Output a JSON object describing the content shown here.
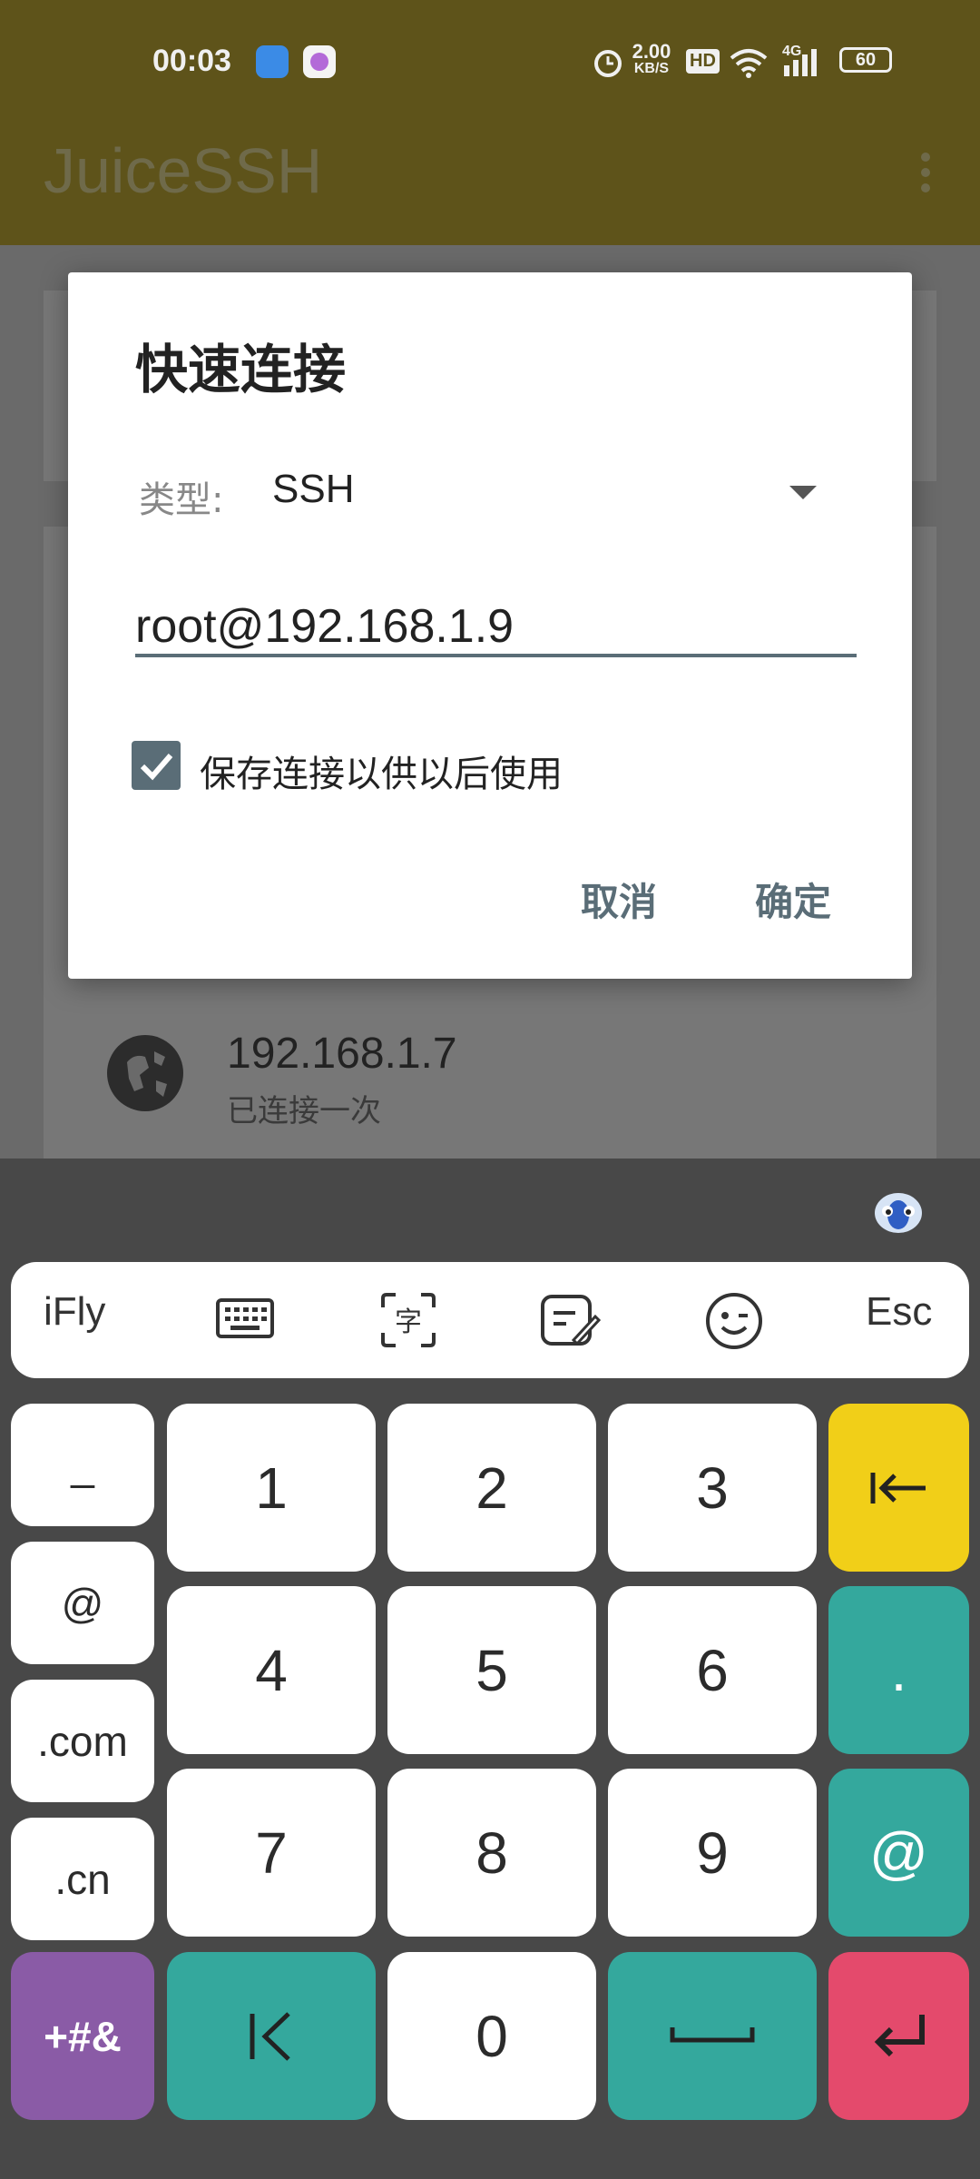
{
  "status_bar": {
    "time": "00:03",
    "speed": "2.00",
    "speed_unit": "KB/S",
    "hd": "HD",
    "network": "4G",
    "battery": "60"
  },
  "app_bar": {
    "title": "JuiceSSH"
  },
  "dialog": {
    "title": "快速连接",
    "type_label": "类型:",
    "type_value": "SSH",
    "host_value": "root@192.168.1.9",
    "save_label": "保存连接以供以后使用",
    "save_checked": true,
    "cancel_label": "取消",
    "ok_label": "确定"
  },
  "background_list": {
    "item_title": "192.168.1.7",
    "item_subtitle": "已连接一次"
  },
  "keyboard": {
    "toolbar": {
      "ifly": "iFly",
      "esc": "Esc"
    },
    "side_keys": [
      "_",
      "@",
      ".com",
      ".cn"
    ],
    "num_keys": [
      "1",
      "2",
      "3",
      "4",
      "5",
      "6",
      "7",
      "8",
      "9",
      "0"
    ],
    "right_keys": [
      ".",
      "@"
    ],
    "symbol_key": "+#&"
  },
  "colors": {
    "app_bar": "#5e531a",
    "accent": "#5a6d77",
    "teal": "#34a89d",
    "yellow": "#f1cf18",
    "purple": "#8a5ba6",
    "red": "#e44a6c"
  }
}
